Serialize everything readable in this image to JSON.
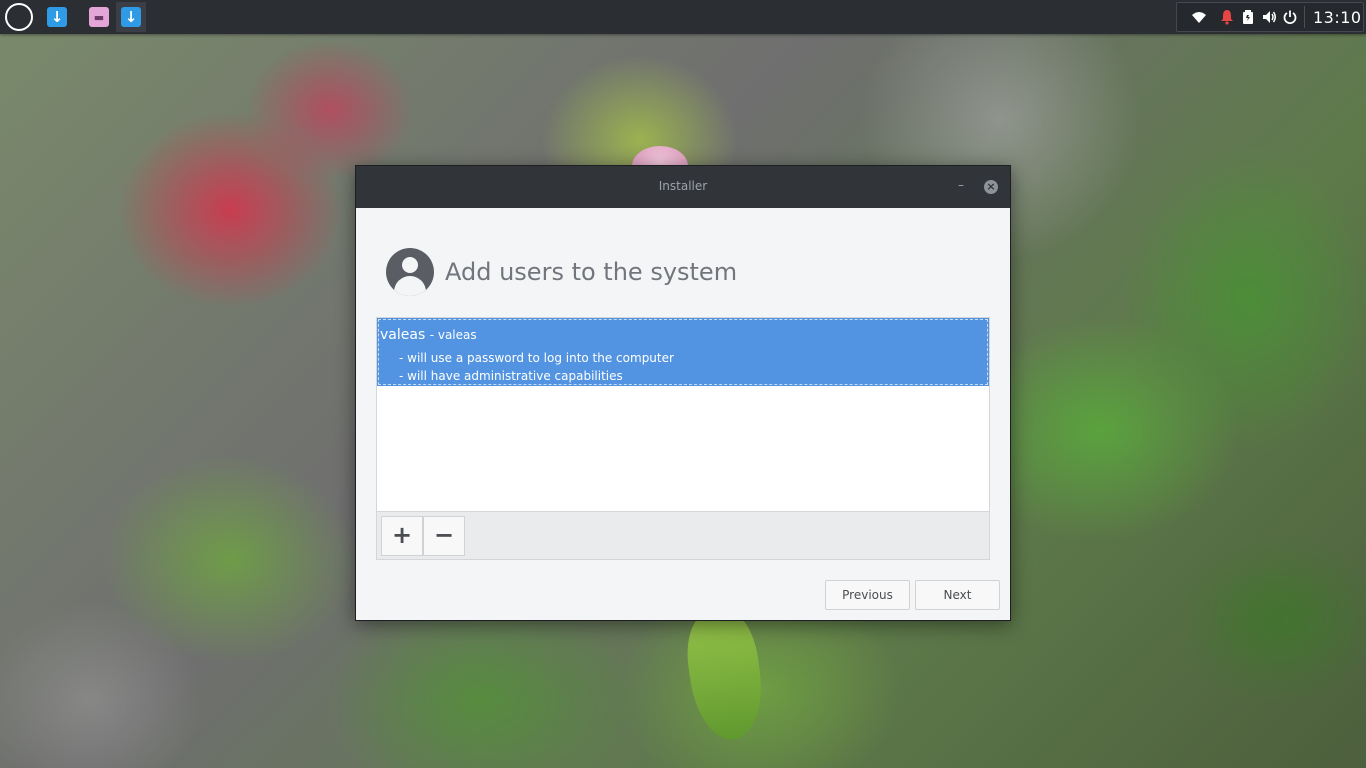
{
  "taskbar": {
    "clock": "13:10",
    "tasks": [
      {
        "icon": "download-arrow-icon",
        "glyph": "↓"
      },
      {
        "icon": "folder-icon",
        "glyph": "▬"
      },
      {
        "icon": "download-arrow-icon",
        "glyph": "↓"
      }
    ],
    "tray": [
      "wifi-icon",
      "notification-bell-icon",
      "battery-icon",
      "volume-icon",
      "power-icon"
    ]
  },
  "window": {
    "title": "Installer",
    "minimize_glyph": "–",
    "close_glyph": "×"
  },
  "page": {
    "heading": "Add users to the system"
  },
  "users": [
    {
      "name": "valeas",
      "login": "- valeas",
      "details": [
        "- will use a password to log into the computer",
        "- will have administrative capabilities"
      ]
    }
  ],
  "toolbar": {
    "add_label": "+",
    "remove_label": "−"
  },
  "nav": {
    "previous_label": "Previous",
    "next_label": "Next"
  },
  "colors": {
    "accent": "#5294e2",
    "panel": "#2b2e33",
    "titlebar": "#31353a",
    "notification": "#e84545"
  }
}
